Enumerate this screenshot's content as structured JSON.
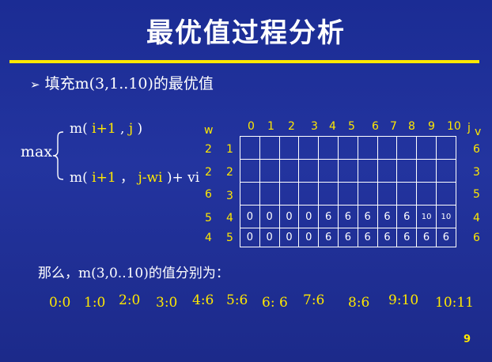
{
  "title": "最优值过程分析",
  "bullet": {
    "lead": "填充",
    "expr": "m(3,1..10)",
    "tail": "的最优值"
  },
  "formula": {
    "max": "max",
    "line1": {
      "pre": "m( ",
      "hl1": "i+1",
      "mid": " , ",
      "hl2": "j",
      "post": " )"
    },
    "line2": {
      "pre": "m( ",
      "hl1": "i+1",
      "mid": " ， ",
      "hl2": "j-wi",
      "post": " )+ vi"
    }
  },
  "table": {
    "w_header": "w",
    "j_header": "j",
    "v_header": "v",
    "j_values": [
      "0",
      "1",
      "2",
      "3",
      "4",
      "5",
      "6",
      "7",
      "8",
      "9",
      "10"
    ],
    "weights": [
      "2",
      "2",
      "6",
      "5",
      "4"
    ],
    "items": [
      "1",
      "2",
      "3",
      "4",
      "5"
    ],
    "vals": [
      "6",
      "3",
      "5",
      "4",
      "6"
    ],
    "rows": [
      [
        "",
        "",
        "",
        "",
        "",
        "",
        "",
        "",
        "",
        "",
        ""
      ],
      [
        "",
        "",
        "",
        "",
        "",
        "",
        "",
        "",
        "",
        "",
        ""
      ],
      [
        "",
        "",
        "",
        "",
        "",
        "",
        "",
        "",
        "",
        "",
        ""
      ],
      [
        "0",
        "0",
        "0",
        "0",
        "6",
        "6",
        "6",
        "6",
        "6",
        "10",
        "10"
      ],
      [
        "0",
        "0",
        "0",
        "0",
        "6",
        "6",
        "6",
        "6",
        "6",
        "6",
        "6"
      ]
    ]
  },
  "summary": {
    "lead": "那么，",
    "expr": "m(3,0..10)",
    "tail": "的值分别为："
  },
  "results": [
    "0:0",
    "1:0",
    "2:0",
    "3:0",
    "4:6",
    "5:6",
    "6: 6",
    "7:6",
    "8:6",
    "9:10",
    "10:11"
  ],
  "page_number": "9"
}
